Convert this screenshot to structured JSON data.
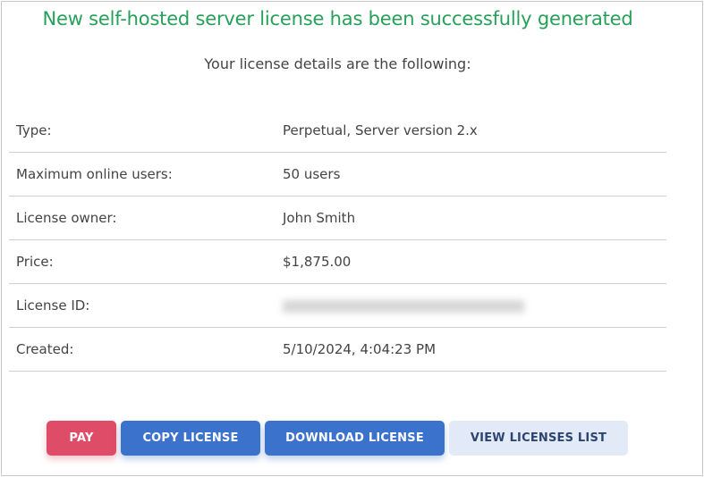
{
  "header": {
    "title": "New self-hosted server license has been successfully generated",
    "subtitle": "Your license details are the following:"
  },
  "details": [
    {
      "label": "Type:",
      "value": "Perpetual, Server version 2.x"
    },
    {
      "label": "Maximum online users:",
      "value": "50 users"
    },
    {
      "label": "License owner:",
      "value": "John Smith"
    },
    {
      "label": "Price:",
      "value": "$1,875.00"
    },
    {
      "label": "License ID:",
      "value": null
    },
    {
      "label": "Created:",
      "value": "5/10/2024, 4:04:23 PM"
    }
  ],
  "buttons": {
    "pay": "PAY",
    "copy": "COPY LICENSE",
    "download": "DOWNLOAD LICENSE",
    "view": "VIEW LICENSES LIST"
  },
  "colors": {
    "success": "#27a05a",
    "danger": "#de4c67",
    "primary": "#3b73cc",
    "secondary": "#e2eaf7"
  }
}
